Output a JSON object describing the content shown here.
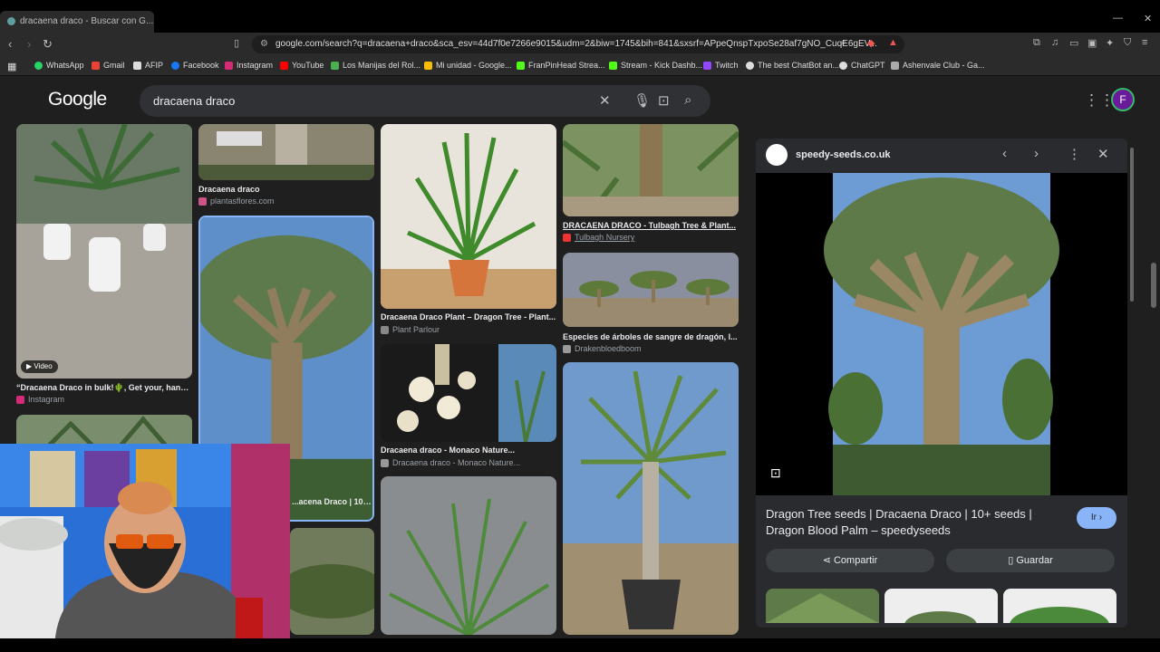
{
  "browser": {
    "tab_title": "dracaena draco - Buscar con G...",
    "url": "google.com/search?q=dracaena+draco&sca_esv=44d7f0e7266e9015&udm=2&biw=1745&bih=841&sxsrf=APpeQnspTxpoSe28af7gNO_CuqE6gEV...",
    "bookmarks": [
      "WhatsApp",
      "Gmail",
      "AFIP",
      "Facebook",
      "Instagram",
      "YouTube",
      "Los Manijas del Rol...",
      "Mi unidad - Google...",
      "FranPinHead Strea...",
      "Stream - Kick Dashb...",
      "Twitch",
      "The best ChatBot an...",
      "ChatGPT",
      "Ashenvale Club - Ga..."
    ]
  },
  "google": {
    "logo": "Google",
    "query": "dracaena draco",
    "avatar_letter": "F"
  },
  "results": [
    {
      "title": "“Dracaena Draco in bulk!🌵, Get your, hand...",
      "source": "Instagram",
      "badge": "▶ Video"
    },
    {
      "title": "Dracaena draco",
      "source": "plantasflores.com"
    },
    {
      "title": "...acena Draco | 10+..."
    },
    {
      "title": "Dracaena Draco Plant – Dragon Tree - Plant...",
      "source": "Plant Parlour"
    },
    {
      "title": "Dracaena draco - Monaco Nature...",
      "source": "Dracaena draco - Monaco Nature..."
    },
    {
      "title": "DRACAENA DRACO - Tulbagh Tree & Plant...",
      "source": "Tulbagh Nursery"
    },
    {
      "title": "Especies de árboles de sangre de dragón, l...",
      "source": "Drakenbloedboom"
    }
  ],
  "panel": {
    "domain": "speedy-seeds.co.uk",
    "title": "Dragon Tree seeds | Dracaena Draco | 10+ seeds | Dragon Blood Palm – speedyseeds",
    "go_label": "Ir ›",
    "share_label": "Compartir",
    "save_label": "Guardar"
  },
  "colors": {
    "background": "#1f1f1f",
    "search": "#303134",
    "panel": "#2a2b2e",
    "accent": "#8ab4f8"
  }
}
